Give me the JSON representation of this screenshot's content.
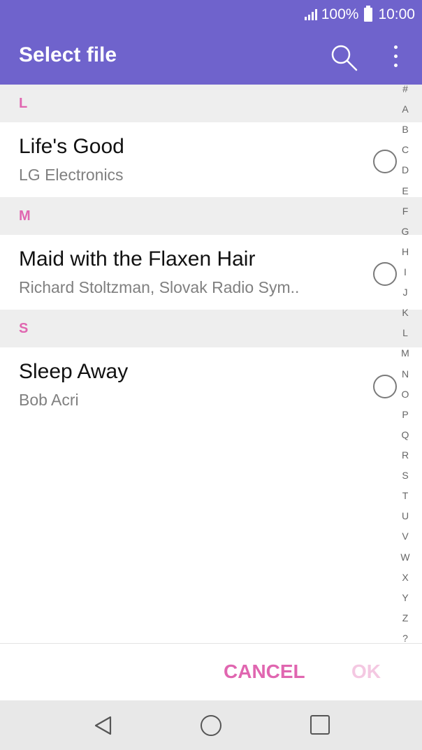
{
  "status": {
    "battery": "100%",
    "time": "10:00"
  },
  "appbar": {
    "title": "Select file",
    "search_icon": "search-icon",
    "more_icon": "more-vert-icon"
  },
  "sections": [
    {
      "letter": "L",
      "items": [
        {
          "title": "Life's Good",
          "subtitle": "LG Electronics",
          "selected": false
        }
      ]
    },
    {
      "letter": "M",
      "items": [
        {
          "title": "Maid with the Flaxen Hair",
          "subtitle": "Richard Stoltzman, Slovak Radio Sym..",
          "selected": false
        }
      ]
    },
    {
      "letter": "S",
      "items": [
        {
          "title": "Sleep Away",
          "subtitle": "Bob Acri",
          "selected": false
        }
      ]
    }
  ],
  "index": [
    "#",
    "A",
    "B",
    "C",
    "D",
    "E",
    "F",
    "G",
    "H",
    "I",
    "J",
    "K",
    "L",
    "M",
    "N",
    "O",
    "P",
    "Q",
    "R",
    "S",
    "T",
    "U",
    "V",
    "W",
    "X",
    "Y",
    "Z",
    "?"
  ],
  "dialog": {
    "cancel_label": "CANCEL",
    "ok_label": "OK"
  },
  "colors": {
    "appbar": "#6f63cc",
    "accent": "#e066b0",
    "ok_disabled": "#f4c8e2"
  }
}
